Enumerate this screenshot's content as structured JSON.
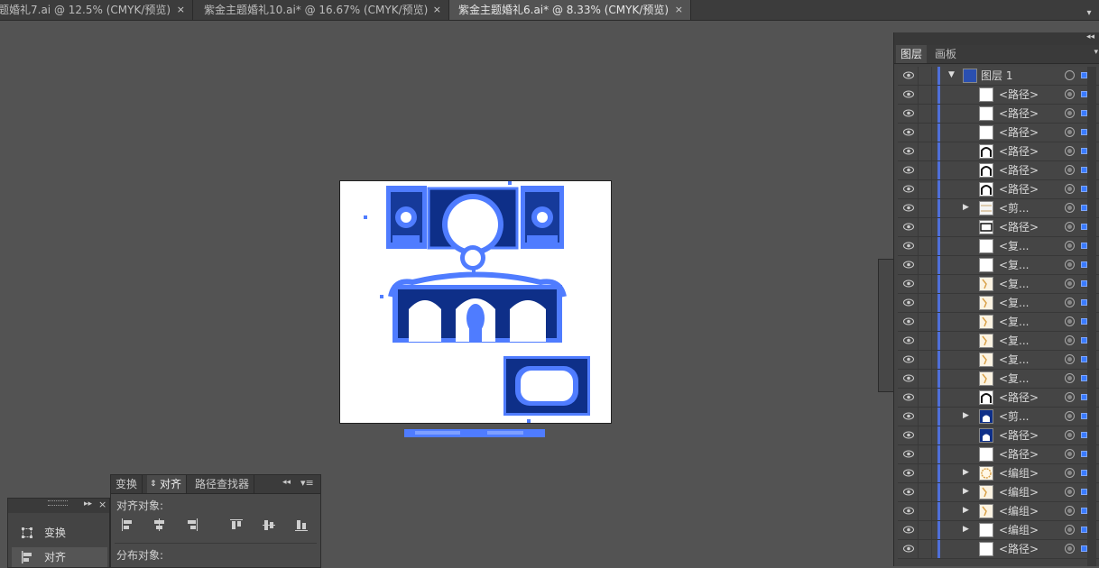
{
  "tabs": [
    {
      "title": "题婚礼7.ai @ 12.5% (CMYK/预览)",
      "close": "×"
    },
    {
      "title": "紫金主题婚礼10.ai* @ 16.67% (CMYK/预览)",
      "close": "×"
    },
    {
      "title": "紫金主题婚礼6.ai* @ 8.33% (CMYK/预览)",
      "close": "×"
    }
  ],
  "layers_panel": {
    "tabs": [
      "图层",
      "画板"
    ],
    "layer": {
      "name": "图层 1"
    },
    "rows": [
      {
        "label": "<路径>",
        "thumb": "white"
      },
      {
        "label": "<路径>",
        "thumb": "white"
      },
      {
        "label": "<路径>",
        "thumb": "white"
      },
      {
        "label": "<路径>",
        "thumb": "arch"
      },
      {
        "label": "<路径>",
        "thumb": "arch"
      },
      {
        "label": "<路径>",
        "thumb": "arch"
      },
      {
        "label": "<剪...",
        "thumb": "lines",
        "expand": "▶"
      },
      {
        "label": "<路径>",
        "thumb": "frame"
      },
      {
        "label": "<复...",
        "thumb": "white"
      },
      {
        "label": "<复...",
        "thumb": "white"
      },
      {
        "label": "<复...",
        "thumb": "gold"
      },
      {
        "label": "<复...",
        "thumb": "gold"
      },
      {
        "label": "<复...",
        "thumb": "gold"
      },
      {
        "label": "<复...",
        "thumb": "gold"
      },
      {
        "label": "<复...",
        "thumb": "gold"
      },
      {
        "label": "<复...",
        "thumb": "gold"
      },
      {
        "label": "<路径>",
        "thumb": "arch"
      },
      {
        "label": "<剪...",
        "thumb": "navy",
        "expand": "▶"
      },
      {
        "label": "<路径>",
        "thumb": "navy"
      },
      {
        "label": "<路径>",
        "thumb": "white"
      },
      {
        "label": "<编组>",
        "thumb": "ring",
        "expand": "▶"
      },
      {
        "label": "<编组>",
        "thumb": "gold",
        "expand": "▶"
      },
      {
        "label": "<编组>",
        "thumb": "gold",
        "expand": "▶"
      },
      {
        "label": "<编组>",
        "thumb": "white",
        "expand": "▶"
      },
      {
        "label": "<路径>",
        "thumb": "white"
      }
    ]
  },
  "align_panel": {
    "tabs": [
      "变换",
      "对齐",
      "路径查找器"
    ],
    "align_objects_label": "对齐对象:",
    "distribute_objects_label": "分布对象:"
  },
  "tool_dock": {
    "items": [
      {
        "label": "变换",
        "icon": "transform-icon"
      },
      {
        "label": "对齐",
        "icon": "align-icon"
      }
    ]
  },
  "colors": {
    "selection": "#4f7cff",
    "navy": "#0a1f5c",
    "accent": "#4f6fd8"
  }
}
